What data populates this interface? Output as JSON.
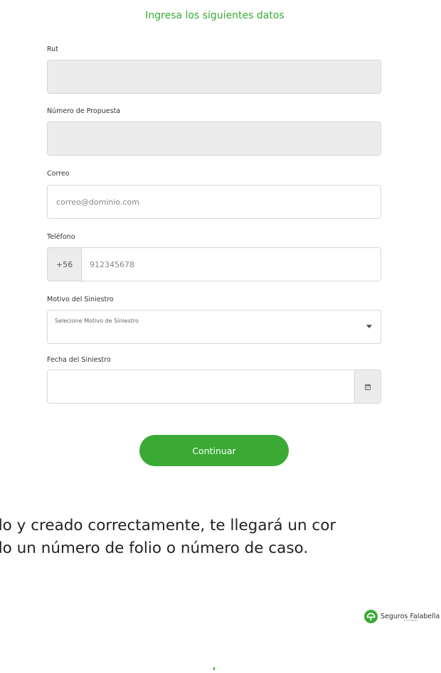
{
  "form": {
    "title": "Ingresa los siguientes datos",
    "rut": {
      "label": "Rut",
      "value": ""
    },
    "propuesta": {
      "label": "Número de Propuesta",
      "value": ""
    },
    "correo": {
      "label": "Correo",
      "placeholder": "correo@dominio.com"
    },
    "telefono": {
      "label": "Teléfono",
      "prefix": "+56",
      "placeholder": "912345678"
    },
    "motivo": {
      "label": "Motivo del Siniestro",
      "selected": "Selecione Motivo de Siniestro"
    },
    "fecha": {
      "label": "Fecha del Siniestro",
      "value": "",
      "icon": "calendar-icon"
    },
    "submit_label": "Continuar"
  },
  "info": {
    "line1": "do y creado correctamente, te llegará un cor",
    "line2": "do un número de folio o número de caso."
  },
  "footer": {
    "brand_name": "Seguros Falabella",
    "brand_sub": "Corredores",
    "logo_icon": "seguros-falabella-logo-icon"
  },
  "colors": {
    "accent": "#3aaa35",
    "disabled_bg": "#ececec",
    "border": "#d7d7d7"
  }
}
